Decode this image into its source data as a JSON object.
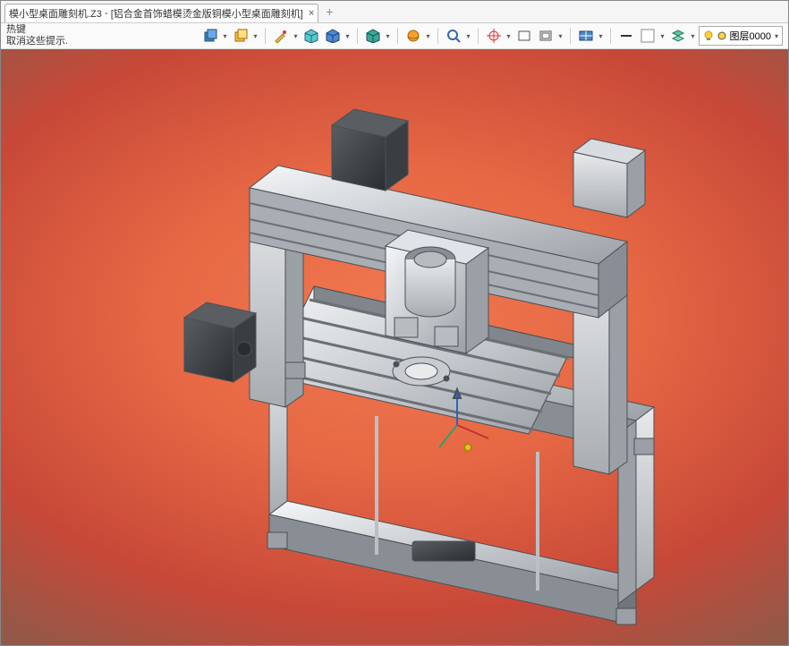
{
  "tab": {
    "filename": "模小型桌面雕刻机.Z3",
    "partname": "[铝合金首饰蜡模烫金版铜模小型桌面雕刻机]",
    "close": "×",
    "add": "+"
  },
  "hints": {
    "line1": "热键",
    "line2": "取消这些提示."
  },
  "layer": {
    "label": "图层0000"
  },
  "icons": {
    "i1": "cube-blue",
    "i2": "cube-yellow",
    "i3": "brush",
    "i4": "box-cyan",
    "i5": "box-blue",
    "i6": "box-teal",
    "i7": "sphere",
    "i8": "lens",
    "i9": "target",
    "i10": "rect",
    "i11": "rect2",
    "i12": "grid",
    "i13": "minus",
    "i14": "swatch",
    "i15": "layers"
  }
}
